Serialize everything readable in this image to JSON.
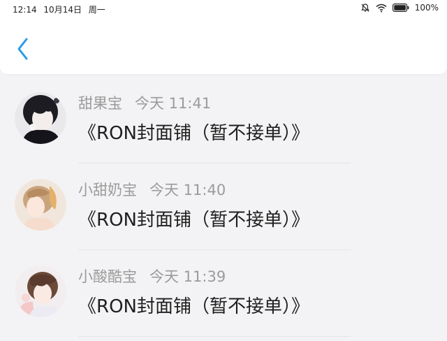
{
  "status_bar": {
    "time": "12:14",
    "date": "10月14日",
    "weekday": "周一",
    "battery": "100%",
    "icons": [
      "silent-bell-icon",
      "wifi-icon",
      "battery-icon"
    ]
  },
  "header": {
    "back_icon": "chevron-left-icon",
    "accent_color": "#2b9be6"
  },
  "messages": [
    {
      "name": "甜果宝",
      "time": "今天 11:41",
      "text": "《RON封面铺（暂不接单）》",
      "avatar": "avatar-dark-hair-boy"
    },
    {
      "name": "小甜奶宝",
      "time": "今天 11:40",
      "text": "《RON封面铺（暂不接单）》",
      "avatar": "avatar-blonde-boy"
    },
    {
      "name": "小酸酷宝",
      "time": "今天 11:39",
      "text": "《RON封面铺（暂不接单）》",
      "avatar": "avatar-brown-hair-boy"
    }
  ]
}
